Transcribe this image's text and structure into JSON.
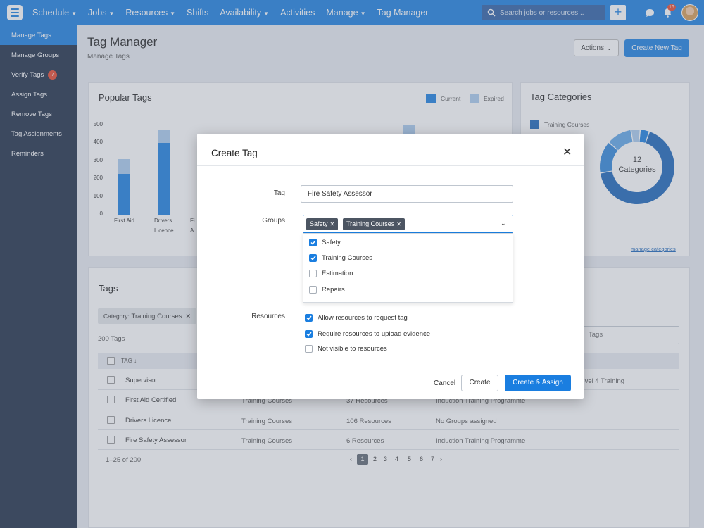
{
  "topnav": {
    "items": [
      {
        "label": "Schedule",
        "caret": true
      },
      {
        "label": "Jobs",
        "caret": true
      },
      {
        "label": "Resources",
        "caret": true
      },
      {
        "label": "Shifts",
        "caret": false
      },
      {
        "label": "Availability",
        "caret": true
      },
      {
        "label": "Activities",
        "caret": false
      },
      {
        "label": "Manage",
        "caret": true
      },
      {
        "label": "Tag Manager",
        "caret": false
      }
    ],
    "search_placeholder": "Search jobs or resources...",
    "notification_count": "16",
    "accent": "#1a7ee0"
  },
  "sidebar": {
    "items": [
      {
        "label": "Manage Tags",
        "active": true
      },
      {
        "label": "Manage Groups"
      },
      {
        "label": "Verify Tags",
        "badge": "7"
      },
      {
        "label": "Assign Tags"
      },
      {
        "label": "Remove Tags"
      },
      {
        "label": "Tag Assignments"
      },
      {
        "label": "Reminders"
      }
    ]
  },
  "header": {
    "title": "Tag Manager",
    "subtitle": "Manage Tags",
    "actions_label": "Actions",
    "create_new_label": "Create New Tag"
  },
  "popular": {
    "title": "Popular Tags",
    "legend_current": "Current",
    "legend_expired": "Expired"
  },
  "chart_data": {
    "type": "bar",
    "title": "Popular Tags",
    "categories": [
      "First Aid",
      "Drivers Licence",
      "Fi",
      "",
      "",
      "",
      "",
      ""
    ],
    "visible_category_labels": [
      [
        "First Aid"
      ],
      [
        "Drivers",
        "Licence"
      ],
      [
        "Fi",
        "A"
      ]
    ],
    "series": [
      {
        "name": "Current",
        "color": "#1a7ee0",
        "values": [
          230,
          400
        ]
      },
      {
        "name": "Expired",
        "color": "#a9cbee",
        "values": [
          80,
          75
        ]
      }
    ],
    "extra_bar": {
      "current": 440,
      "expired": 60
    },
    "yticks": [
      0,
      100,
      200,
      300,
      400,
      500
    ],
    "ylim": [
      0,
      520
    ]
  },
  "categories": {
    "title": "Tag Categories",
    "legend_label": "Training Courses",
    "center_count": "12",
    "center_label": "Categories",
    "manage_link": "manage categories",
    "donut": [
      {
        "value": 67,
        "color": "#1a64b8"
      },
      {
        "value": 14,
        "color": "#2f86db"
      },
      {
        "value": 11,
        "color": "#5ea6e8"
      },
      {
        "value": 4,
        "color": "#a9cbee"
      },
      {
        "value": 4,
        "color": "#1a7ee0"
      }
    ]
  },
  "tags": {
    "title": "Tags",
    "filter_prefix": "Category:",
    "filter_value": "Training Courses",
    "count": "200 Tags",
    "search_placeholder_fragment": "Tags",
    "col_tag": "TAG",
    "rows": [
      {
        "name": "Supervisor",
        "category": "",
        "resources": "",
        "groups": "Level 4 Training"
      },
      {
        "name": "First Aid Certified",
        "category": "Training Courses",
        "resources": "37 Resources",
        "groups": "Induction Training Programme"
      },
      {
        "name": "Drivers Licence",
        "category": "Training Courses",
        "resources": "106 Resources",
        "groups": "No Groups assigned"
      },
      {
        "name": "Fire Safety Assessor",
        "category": "Training Courses",
        "resources": "6 Resources",
        "groups": "Induction Training Programme"
      }
    ],
    "range": "1–25 of 200",
    "pages": [
      "‹",
      "1",
      "2",
      "3",
      "4",
      "5",
      "6",
      "7",
      "›"
    ],
    "current_page": "1"
  },
  "modal": {
    "title": "Create Tag",
    "tag_label": "Tag",
    "tag_value": "Fire Safety Assessor",
    "groups_label": "Groups",
    "selected_groups": [
      "Safety",
      "Training Courses"
    ],
    "group_options": [
      {
        "label": "Safety",
        "checked": true
      },
      {
        "label": "Training Courses",
        "checked": true
      },
      {
        "label": "Estimation",
        "checked": false
      },
      {
        "label": "Repairs",
        "checked": false
      }
    ],
    "resources_label": "Resources",
    "resource_options": [
      {
        "label": "Allow resources to request tag",
        "checked": true
      },
      {
        "label": "Require resources to upload evidence",
        "checked": true
      },
      {
        "label": "Not visible to resources",
        "checked": false
      }
    ],
    "cancel_label": "Cancel",
    "create_label": "Create",
    "create_assign_label": "Create & Assign"
  }
}
